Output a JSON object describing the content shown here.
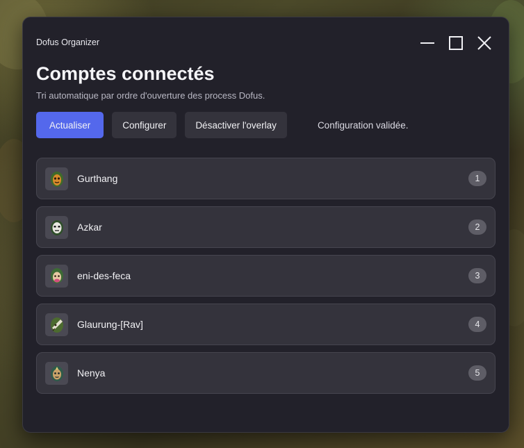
{
  "window": {
    "app_title": "Dofus Organizer",
    "controls": {
      "minimize": "minimize-icon",
      "maximize": "maximize-icon",
      "close": "close-icon"
    }
  },
  "header": {
    "title": "Comptes connectés",
    "subtitle": "Tri automatique par ordre d'ouverture des process Dofus."
  },
  "toolbar": {
    "refresh_label": "Actualiser",
    "configure_label": "Configurer",
    "overlay_label": "Désactiver l'overlay",
    "status_text": "Configuration validée."
  },
  "accounts": [
    {
      "name": "Gurthang",
      "order": "1",
      "icon": "character-avatar-icon"
    },
    {
      "name": "Azkar",
      "order": "2",
      "icon": "character-avatar-icon"
    },
    {
      "name": "eni-des-feca",
      "order": "3",
      "icon": "character-avatar-icon"
    },
    {
      "name": "Glaurung-[Rav]",
      "order": "4",
      "icon": "character-avatar-icon"
    },
    {
      "name": "Nenya",
      "order": "5",
      "icon": "character-avatar-icon"
    }
  ],
  "colors": {
    "accent": "#5468ec",
    "window_bg": "#22212a",
    "row_bg": "#34333c",
    "badge_bg": "#5e5d66"
  }
}
